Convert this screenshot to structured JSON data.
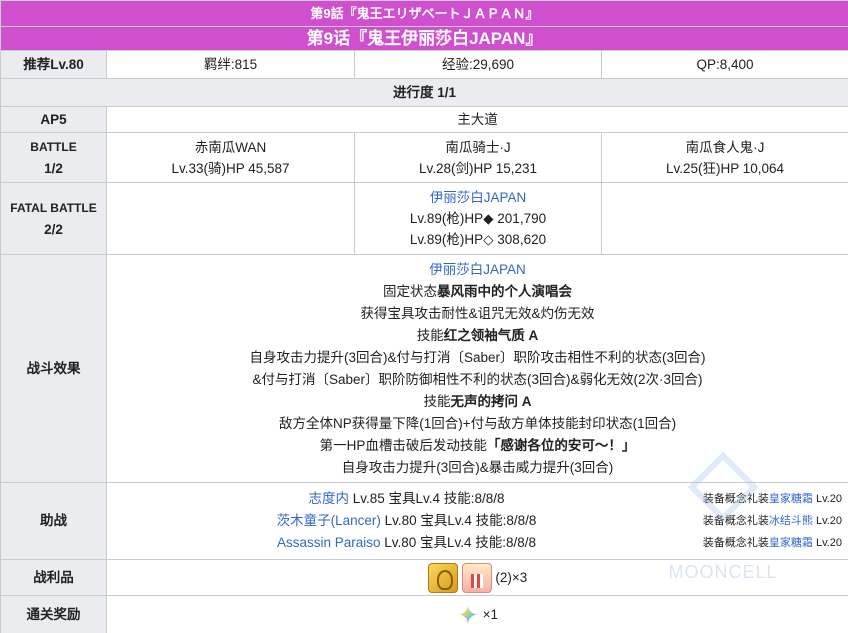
{
  "header": {
    "subtitle": "第9話『鬼王エリザベートＪＡＰＡＮ』",
    "title": "第9话『鬼王伊丽莎白JAPAN』"
  },
  "info_row": {
    "recommended_level": "推荐Lv.80",
    "bond": "羁绊:815",
    "exp": "经验:29,690",
    "qp": "QP:8,400"
  },
  "progress": "进行度 1/1",
  "ap_row": {
    "label": "AP5",
    "value": "主大道"
  },
  "battle1": {
    "label_line1": "BATTLE",
    "label_line2": "1/2",
    "enemies": [
      {
        "name": "赤南瓜WAN",
        "stats": "Lv.33(骑)HP 45,587"
      },
      {
        "name": "南瓜骑士·J",
        "stats": "Lv.28(剑)HP 15,231"
      },
      {
        "name": "南瓜食人鬼·J",
        "stats": "Lv.25(狂)HP 10,064"
      }
    ]
  },
  "battle2": {
    "label_line1": "FATAL BATTLE",
    "label_line2": "2/2",
    "enemy_name": "伊丽莎白JAPAN",
    "stats1": "Lv.89(枪)HP◆ 201,790",
    "stats2": "Lv.89(枪)HP◇ 308,620"
  },
  "effects": {
    "label": "战斗效果",
    "lines": [
      {
        "pre": "",
        "bold": "",
        "post": "伊丽莎白JAPAN",
        "link": true
      },
      {
        "pre": "固定状态",
        "bold": "暴风雨中的个人演唱会",
        "post": ""
      },
      {
        "pre": "获得宝具攻击耐性&诅咒无效&灼伤无效",
        "bold": "",
        "post": ""
      },
      {
        "pre": "技能",
        "bold": "红之领袖气质 A",
        "post": ""
      },
      {
        "pre": "自身攻击力提升(3回合)&付与打消〔Saber〕职阶攻击相性不利的状态(3回合)",
        "bold": "",
        "post": ""
      },
      {
        "pre": "&付与打消〔Saber〕职阶防御相性不利的状态(3回合)&弱化无效(2次·3回合)",
        "bold": "",
        "post": ""
      },
      {
        "pre": "技能",
        "bold": "无声的拷问 A",
        "post": ""
      },
      {
        "pre": "敌方全体NP获得量下降(1回合)+付与敌方单体技能封印状态(1回合)",
        "bold": "",
        "post": ""
      },
      {
        "pre": "第一HP血槽击破后发动技能",
        "bold": "「感谢各位的安可～！」",
        "post": ""
      },
      {
        "pre": "自身攻击力提升(3回合)&暴击威力提升(3回合)",
        "bold": "",
        "post": ""
      }
    ]
  },
  "support": {
    "label": "助战",
    "entries": [
      {
        "name": "志度内",
        "detail": " Lv.85 宝具Lv.4 技能:8/8/8",
        "ce_prefix": "装备概念礼装",
        "ce_name": "皇家糖霜",
        "ce_level": " Lv.20"
      },
      {
        "name": "茨木童子(Lancer)",
        "detail": " Lv.80 宝具Lv.4 技能:8/8/8",
        "ce_prefix": "装备概念礼装",
        "ce_name": "冰结斗熊",
        "ce_level": " Lv.20"
      },
      {
        "name": "Assassin Paraiso",
        "detail": " Lv.80 宝具Lv.4 技能:8/8/8",
        "ce_prefix": "装备概念礼装",
        "ce_name": "皇家糖霜",
        "ce_level": " Lv.20"
      }
    ]
  },
  "drops": {
    "label": "战利品",
    "items": [
      {
        "icon": "golden-item-icon"
      },
      {
        "icon": "popcorn-item-icon"
      }
    ],
    "count_text": "(2)×3"
  },
  "rewards": {
    "label": "通关奖励",
    "icon": "saint-quartz-icon",
    "count_text": "×1"
  },
  "watermark": "MOONCELL",
  "colors": {
    "header_bg": "#d04fcf",
    "label_bg": "#eaecf0",
    "link": "#3366cc",
    "border": "#c8ccd1"
  }
}
